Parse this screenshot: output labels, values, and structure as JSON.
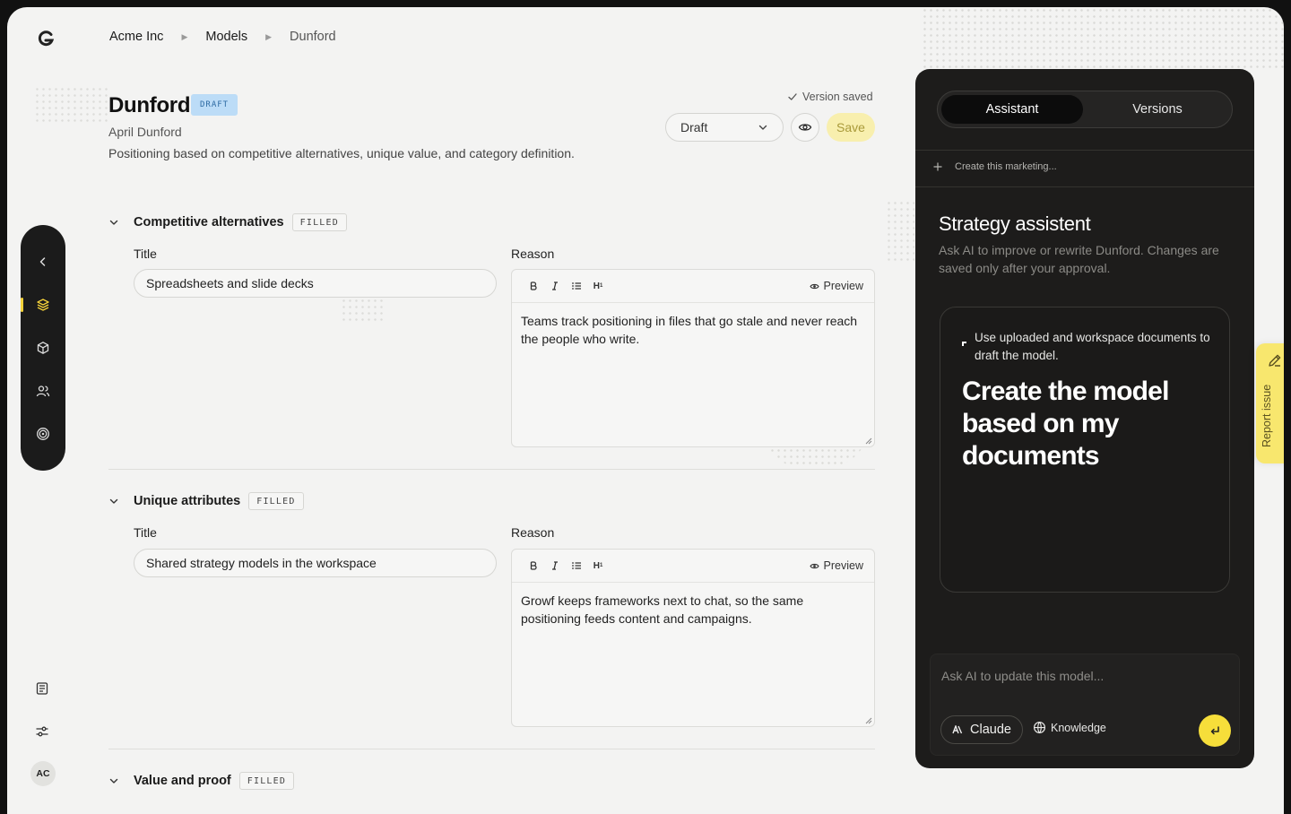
{
  "breadcrumb": [
    "Acme Inc",
    "Models",
    "Dunford"
  ],
  "header": {
    "title": "Dunford",
    "badge": "DRAFT",
    "author": "April Dunford",
    "description": "Positioning based on competitive alternatives, unique value, and category definition.",
    "version_status": "Version saved",
    "status_value": "Draft",
    "save_label": "Save"
  },
  "sidebar": {
    "avatar_initials": "AC",
    "active_item": "models",
    "accent_color": "#f4d23a"
  },
  "sections": [
    {
      "title": "Competitive alternatives",
      "badge": "FILLED",
      "title_label": "Title",
      "title_value": "Spreadsheets and slide decks",
      "reason_label": "Reason",
      "preview_label": "Preview",
      "reason_text": "Teams track positioning in files that go stale and never reach the people who write."
    },
    {
      "title": "Unique attributes",
      "badge": "FILLED",
      "title_label": "Title",
      "title_value": "Shared strategy models in the workspace",
      "reason_label": "Reason",
      "preview_label": "Preview",
      "reason_text": "Growf keeps frameworks next to chat, so the same positioning feeds content and campaigns."
    },
    {
      "title": "Value and proof",
      "badge": "FILLED"
    }
  ],
  "assistant": {
    "tabs": [
      "Assistant",
      "Versions"
    ],
    "active_tab": "Assistant",
    "create_row": "Create this marketing...",
    "title": "Strategy assistent",
    "description": "Ask AI to improve or rewrite Dunford. Changes are saved only after your approval.",
    "suggestion_sub": "Use uploaded and workspace documents to draft the model.",
    "suggestion_main": "Create the model based on my documents",
    "chat_placeholder": "Ask AI to update this model...",
    "model_label": "Claude",
    "knowledge_label": "Knowledge",
    "send_color": "#f6de3a"
  },
  "report": {
    "label": "Report issue",
    "color": "#f8e76e"
  }
}
